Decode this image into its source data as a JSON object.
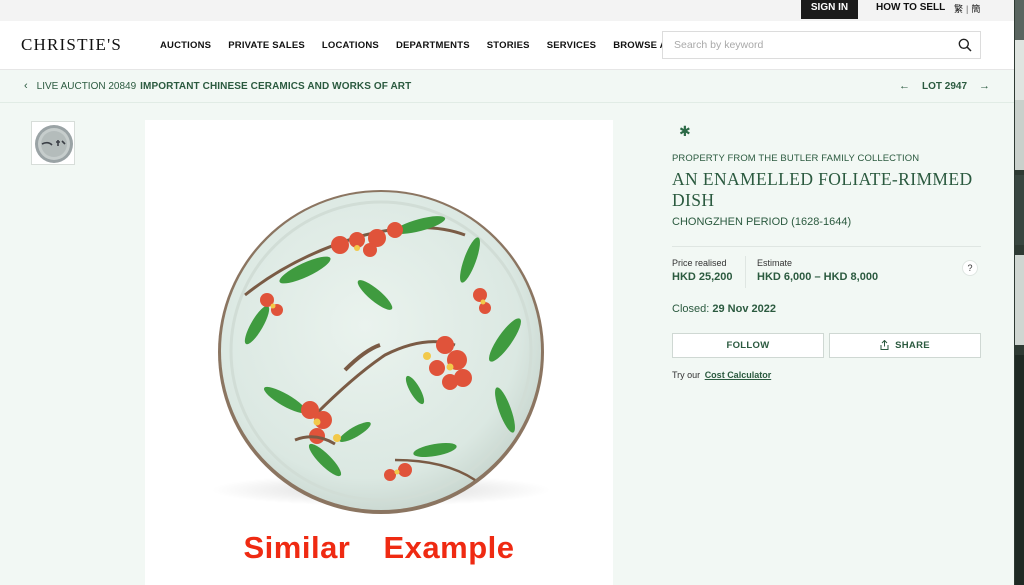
{
  "topbar": {
    "sign_in": "SIGN IN",
    "how_to_sell": "HOW TO SELL",
    "lang_traditional": "繁",
    "lang_simplified": "簡"
  },
  "header": {
    "logo": "CHRISTIE'S",
    "nav": [
      "AUCTIONS",
      "PRIVATE SALES",
      "LOCATIONS",
      "DEPARTMENTS",
      "STORIES",
      "SERVICES",
      "BROWSE ALL"
    ],
    "search_placeholder": "Search by keyword",
    "search_icon": "search-icon"
  },
  "breadcrumb": {
    "sale_prefix": "LIVE AUCTION 20849",
    "sale_title": "IMPORTANT CHINESE CERAMICS AND WORKS OF ART",
    "lot_label": "LOT 2947"
  },
  "image": {
    "overlay_text": "Similar Example"
  },
  "lot": {
    "provenance": "PROPERTY FROM THE BUTLER FAMILY COLLECTION",
    "title": "AN ENAMELLED FOLIATE-RIMMED DISH",
    "period": "CHONGZHEN PERIOD (1628-1644)",
    "price_label": "Price realised",
    "price_value": "HKD 25,200",
    "estimate_label": "Estimate",
    "estimate_value": "HKD 6,000 – HKD 8,000",
    "help": "?",
    "closed_label": "Closed:",
    "closed_date": "29 Nov 2022",
    "follow": "FOLLOW",
    "share": "SHARE",
    "try_prefix": "Try our",
    "cost_calculator": "Cost Calculator"
  },
  "colors": {
    "brand_green": "#2b5a3f",
    "panel_bg": "#f2f8f4",
    "overlay_red": "#ef2a12"
  }
}
